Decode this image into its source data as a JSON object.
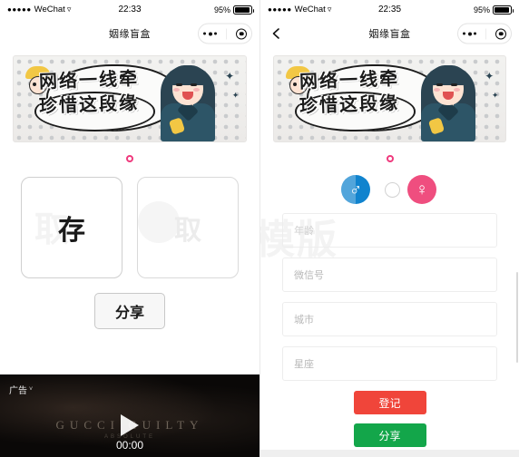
{
  "left": {
    "status": {
      "signal_dots": "●●●●●",
      "carrier": "WeChat",
      "wifi_icon": "wifi-icon",
      "time": "22:33",
      "battery_pct": "95%"
    },
    "nav": {
      "title": "姻缘盲盒",
      "capsule_more": "more-icon",
      "capsule_target": "target-icon"
    },
    "banner": {
      "line1": "网络一线牵",
      "line2": "珍惜这段缘",
      "alt": "banner-illustration"
    },
    "loader": "loading-ring",
    "watermark": "取",
    "cards": [
      {
        "label": "存",
        "state": "active"
      },
      {
        "label": "取",
        "state": "ghost"
      }
    ],
    "share_label": "分享",
    "ad": {
      "tag": "广告",
      "chevron": "˅",
      "brand": "GUCCI GUILTY",
      "sub": "ABSOLUTE",
      "play_icon": "play-icon",
      "time": "00:00"
    }
  },
  "right": {
    "status": {
      "signal_dots": "●●●●●",
      "carrier": "WeChat",
      "wifi_icon": "wifi-icon",
      "time": "22:35",
      "battery_pct": "95%"
    },
    "nav": {
      "back_icon": "back-chevron-icon",
      "title": "姻缘盲盒"
    },
    "banner": {
      "line1": "网络一线牵",
      "line2": "珍惜这段缘"
    },
    "loader": "loading-ring",
    "watermark": "淘模版",
    "gender": {
      "male_symbol": "♂",
      "female_symbol": "♀",
      "male_selected": true,
      "female_selected": false
    },
    "fields": [
      {
        "name": "age",
        "placeholder": "年龄",
        "value": ""
      },
      {
        "name": "wechat-id",
        "placeholder": "微信号",
        "value": ""
      },
      {
        "name": "city",
        "placeholder": "城市",
        "value": ""
      },
      {
        "name": "zodiac",
        "placeholder": "星座",
        "value": ""
      }
    ],
    "register_label": "登记",
    "share_label": "分享"
  },
  "colors": {
    "accent_pink": "#ef3a7d",
    "male_blue": "#1083ce",
    "female_pink": "#ef4e7f",
    "register_red": "#f0453a",
    "share_green": "#13a64a"
  }
}
